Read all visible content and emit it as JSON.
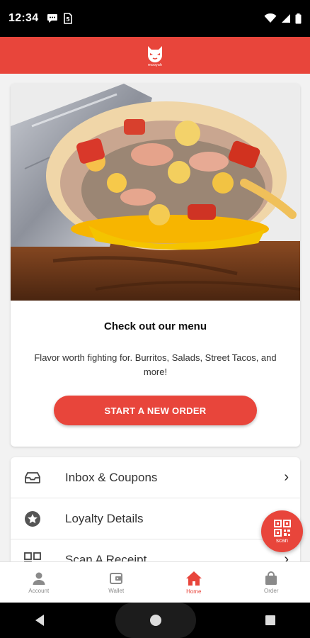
{
  "status_bar": {
    "time": "12:34",
    "icons": [
      "chat-bubble-icon",
      "sim-icon",
      "wifi-icon",
      "signal-icon",
      "battery-icon"
    ]
  },
  "app_header": {
    "logo": "cat-logo-icon",
    "logo_text": "mooyah",
    "background": "#e8453b"
  },
  "menu_card": {
    "title": "Check out our menu",
    "description": "Flavor worth fighting for. Burritos, Salads, Street Tacos, and more!",
    "button_label": "START A NEW ORDER"
  },
  "list_items": [
    {
      "label": "Inbox & Coupons",
      "icon": "inbox-icon"
    },
    {
      "label": "Loyalty Details",
      "icon": "star-badge-icon"
    },
    {
      "label": "Scan A Receipt",
      "icon": "receipt-scan-icon"
    }
  ],
  "fab": {
    "label": "scan",
    "icon": "qr-code-icon"
  },
  "bottom_nav": [
    {
      "label": "Account",
      "icon": "person-icon",
      "active": false
    },
    {
      "label": "Wallet",
      "icon": "wallet-icon",
      "active": false
    },
    {
      "label": "Home",
      "icon": "home-icon",
      "active": true
    },
    {
      "label": "Order",
      "icon": "shopping-bag-icon",
      "active": false
    }
  ],
  "colors": {
    "accent": "#e8453b",
    "inactive": "#8a8a8a"
  }
}
